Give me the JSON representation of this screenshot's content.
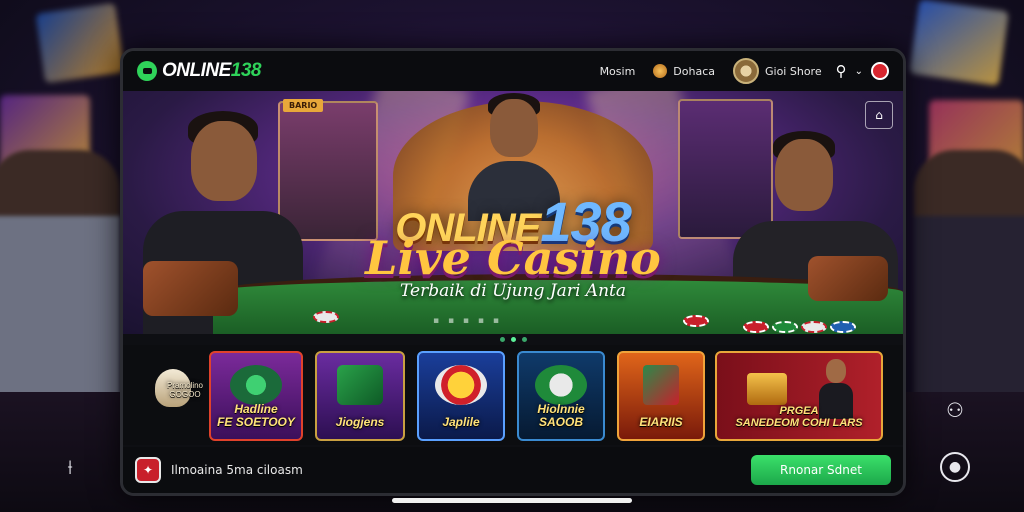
{
  "brand": {
    "name_prefix": "ONLINE",
    "name_number": "138"
  },
  "nav": {
    "items": [
      {
        "label": "Mosim"
      },
      {
        "label": "Dohaca"
      },
      {
        "label": "Gioi Shore"
      }
    ]
  },
  "hero": {
    "badge": "ВАRIO",
    "title_prefix": "ONLINE",
    "title_number": "138",
    "subtitle": "Live Casino",
    "tagline": "Terbaik di Ujung Jari Anta"
  },
  "categories": [
    {
      "label": "Pramolino\nGOGOO"
    },
    {
      "label": "Hadline\nFE SOETOOY"
    },
    {
      "label": "Jiogjens"
    },
    {
      "label": "Japlile"
    },
    {
      "label": "Hiolnnie\nSAOOB"
    },
    {
      "label": "EIARIIS"
    },
    {
      "label": "PRGEA\nSANEDEOM    COHI LARS"
    }
  ],
  "bottom_bar": {
    "text": "Ilmoaina 5ma ciloasm",
    "cta_label": "Rnonar Sdnet"
  },
  "colors": {
    "accent": "#2fd35a",
    "title_gold": "#ffd45a",
    "number_blue": "#6fb8ff",
    "cta_green": "#1ca84a"
  },
  "icons": {
    "logo": "chat-logo-icon",
    "nav": [
      "coin-icon",
      "avatar-icon"
    ],
    "actions": [
      "search-icon",
      "chevron-down-icon",
      "notification-icon"
    ],
    "hero": "fullscreen-icon",
    "outer": [
      "split-icon",
      "share-icon",
      "user-circle-icon"
    ]
  }
}
